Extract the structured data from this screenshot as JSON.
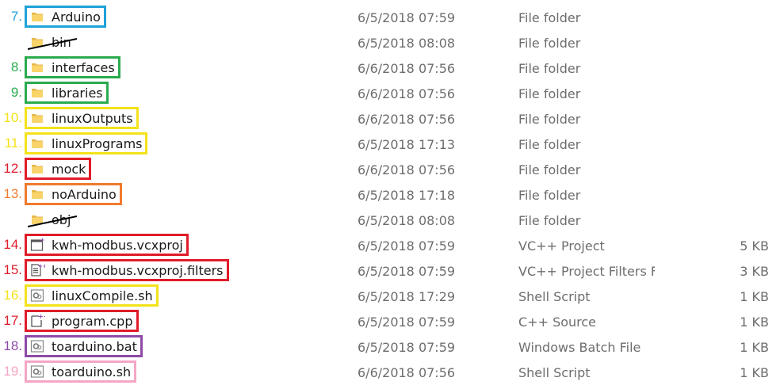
{
  "files": [
    {
      "num": "7.",
      "color": "#1fa2d8",
      "name": "Arduino",
      "date": "6/5/2018 07:59",
      "type": "File folder",
      "size": "",
      "icon": "folder-icon"
    },
    {
      "num": "",
      "color": "",
      "name": "bin",
      "date": "6/5/2018 08:08",
      "type": "File folder",
      "size": "",
      "icon": "folder-icon",
      "struck": true
    },
    {
      "num": "8.",
      "color": "#2aab4e",
      "name": "interfaces",
      "date": "6/6/2018 07:56",
      "type": "File folder",
      "size": "",
      "icon": "folder-icon"
    },
    {
      "num": "9.",
      "color": "#2aab4e",
      "name": "libraries",
      "date": "6/6/2018 07:56",
      "type": "File folder",
      "size": "",
      "icon": "folder-icon"
    },
    {
      "num": "10.",
      "color": "#f4e21a",
      "name": "linuxOutputs",
      "date": "6/6/2018 07:56",
      "type": "File folder",
      "size": "",
      "icon": "folder-icon"
    },
    {
      "num": "11.",
      "color": "#f4e21a",
      "name": "linuxPrograms",
      "date": "6/5/2018 17:13",
      "type": "File folder",
      "size": "",
      "icon": "folder-icon"
    },
    {
      "num": "12.",
      "color": "#e01c2a",
      "name": "mock",
      "date": "6/6/2018 07:56",
      "type": "File folder",
      "size": "",
      "icon": "folder-icon"
    },
    {
      "num": "13.",
      "color": "#f07a2e",
      "name": "noArduino",
      "date": "6/5/2018 17:18",
      "type": "File folder",
      "size": "",
      "icon": "folder-icon"
    },
    {
      "num": "",
      "color": "",
      "name": "obj",
      "date": "6/5/2018 08:08",
      "type": "File folder",
      "size": "",
      "icon": "folder-icon",
      "struck": true
    },
    {
      "num": "14.",
      "color": "#e01c2a",
      "name": "kwh-modbus.vcxproj",
      "date": "6/5/2018 07:59",
      "type": "VC++ Project",
      "size": "5 KB",
      "icon": "vcxproj-icon"
    },
    {
      "num": "15.",
      "color": "#e01c2a",
      "name": "kwh-modbus.vcxproj.filters",
      "date": "6/5/2018 07:59",
      "type": "VC++ Project Filters F",
      "size": "3 KB",
      "icon": "filters-icon"
    },
    {
      "num": "16.",
      "color": "#f4e21a",
      "name": "linuxCompile.sh",
      "date": "6/5/2018 17:29",
      "type": "Shell Script",
      "size": "1 KB",
      "icon": "script-icon"
    },
    {
      "num": "17.",
      "color": "#e01c2a",
      "name": "program.cpp",
      "date": "6/5/2018 07:59",
      "type": "C++ Source",
      "size": "1 KB",
      "icon": "cpp-icon"
    },
    {
      "num": "18.",
      "color": "#8e4aa6",
      "name": "toarduino.bat",
      "date": "6/5/2018 07:59",
      "type": "Windows Batch File",
      "size": "1 KB",
      "icon": "script-icon"
    },
    {
      "num": "19.",
      "color": "#f5a6c6",
      "name": "toarduino.sh",
      "date": "6/6/2018 07:56",
      "type": "Shell Script",
      "size": "1 KB",
      "icon": "script-icon"
    }
  ]
}
